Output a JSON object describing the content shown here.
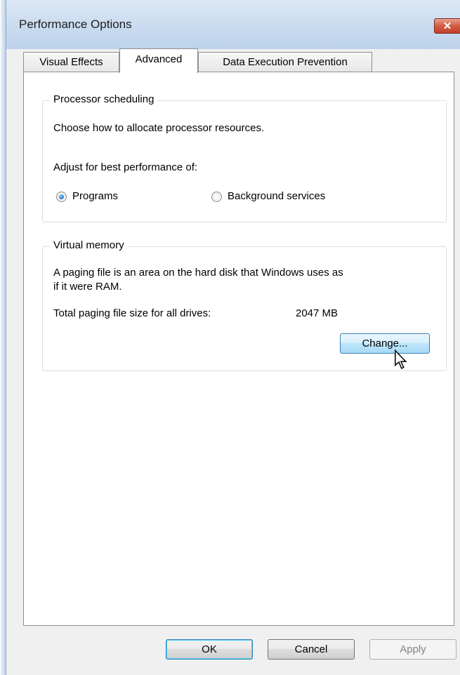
{
  "window": {
    "title": "Performance Options",
    "close_glyph": "✕"
  },
  "tabs": [
    {
      "label": "Visual Effects",
      "active": false
    },
    {
      "label": "Advanced",
      "active": true
    },
    {
      "label": "Data Execution Prevention",
      "active": false
    }
  ],
  "processor_scheduling": {
    "group_label": "Processor scheduling",
    "description": "Choose how to allocate processor resources.",
    "adjust_label": "Adjust for best performance of:",
    "options": [
      {
        "label": "Programs",
        "selected": true
      },
      {
        "label": "Background services",
        "selected": false
      }
    ]
  },
  "virtual_memory": {
    "group_label": "Virtual memory",
    "description_line1": "A paging file is an area on the hard disk that Windows uses as",
    "description_line2": "if it were RAM.",
    "total_label": "Total paging file size for all drives:",
    "total_value": "2047 MB",
    "change_button": "Change..."
  },
  "footer": {
    "ok": "OK",
    "cancel": "Cancel",
    "apply": "Apply"
  },
  "colors": {
    "accent": "#3c7fb1",
    "close": "#c2402a",
    "hover": "#bee6fd"
  },
  "icons": {
    "close": "close-icon",
    "cursor": "mouse-pointer-icon"
  }
}
